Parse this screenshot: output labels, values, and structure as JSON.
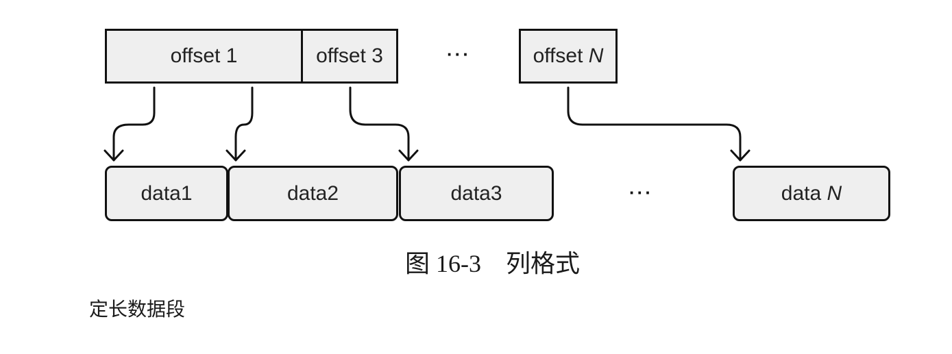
{
  "figure": {
    "offset_row": {
      "boxes": [
        {
          "label": "offset 1",
          "italic_suffix": ""
        },
        {
          "label": "offset 3",
          "italic_suffix": ""
        },
        {
          "label": "offset ",
          "italic_suffix": "N"
        }
      ],
      "ellipsis": "···"
    },
    "data_row": {
      "boxes": [
        {
          "label": "data1",
          "italic_suffix": ""
        },
        {
          "label": "data2",
          "italic_suffix": ""
        },
        {
          "label": "data3",
          "italic_suffix": ""
        },
        {
          "label": "data ",
          "italic_suffix": "N"
        }
      ],
      "ellipsis": "···"
    },
    "arrows": [
      {
        "from": "offset 1 (left)",
        "to": "data1"
      },
      {
        "from": "offset 1 (right)",
        "to": "data2"
      },
      {
        "from": "offset 3",
        "to": "data3"
      },
      {
        "from": "offset N",
        "to": "data N"
      }
    ],
    "caption": {
      "number": "图 16-3",
      "title": "列格式"
    }
  },
  "body": {
    "text": "定长数据段"
  }
}
